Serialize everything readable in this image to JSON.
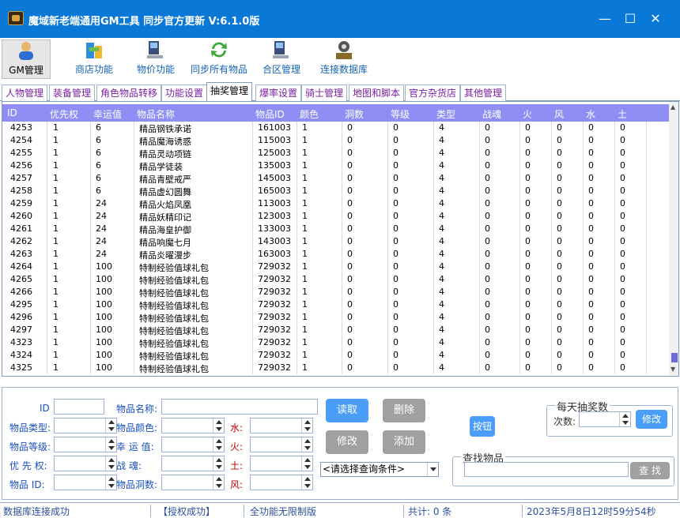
{
  "app": {
    "title": "魔域新老端通用GM工具 同步官方更新 V:6.1.0版"
  },
  "toolbar": {
    "items": [
      {
        "label": "GM管理",
        "icon": "user-icon"
      },
      {
        "label": "商店功能",
        "icon": "shop-icon"
      },
      {
        "label": "物价功能",
        "icon": "computer-icon"
      },
      {
        "label": "同步所有物品",
        "icon": "sync-icon"
      },
      {
        "label": "合区管理",
        "icon": "computer-icon"
      },
      {
        "label": "连接数据库",
        "icon": "database-gear-icon"
      }
    ]
  },
  "tabs": [
    "人物管理",
    "装备管理",
    "角色物品转移",
    "功能设置",
    "抽奖管理",
    "爆率设置",
    "骑士管理",
    "地图和脚本",
    "官方杂货店",
    "其他管理"
  ],
  "grid": {
    "columns": [
      "ID",
      "优先权",
      "幸运值",
      "物品名称",
      "物品ID",
      "颜色",
      "洞数",
      "等级",
      "类型",
      "战魂",
      "火",
      "风",
      "水",
      "土"
    ],
    "rows": [
      [
        "4253",
        "1",
        "6",
        "精品钢铁承诺",
        "161003",
        "1",
        "0",
        "0",
        "4",
        "0",
        "0",
        "0",
        "0",
        "0"
      ],
      [
        "4254",
        "1",
        "6",
        "精品魔海诱惑",
        "115003",
        "1",
        "0",
        "0",
        "4",
        "0",
        "0",
        "0",
        "0",
        "0"
      ],
      [
        "4255",
        "1",
        "6",
        "精品灵动项链",
        "125003",
        "1",
        "0",
        "0",
        "4",
        "0",
        "0",
        "0",
        "0",
        "0"
      ],
      [
        "4256",
        "1",
        "6",
        "精品学徒装",
        "135003",
        "1",
        "0",
        "0",
        "4",
        "0",
        "0",
        "0",
        "0",
        "0"
      ],
      [
        "4257",
        "1",
        "6",
        "精品青壁戒严",
        "145003",
        "1",
        "0",
        "0",
        "4",
        "0",
        "0",
        "0",
        "0",
        "0"
      ],
      [
        "4258",
        "1",
        "6",
        "精品虚幻圆舞",
        "165003",
        "1",
        "0",
        "0",
        "4",
        "0",
        "0",
        "0",
        "0",
        "0"
      ],
      [
        "4259",
        "1",
        "24",
        "精品火焰凤凰",
        "113003",
        "1",
        "0",
        "0",
        "4",
        "0",
        "0",
        "0",
        "0",
        "0"
      ],
      [
        "4260",
        "1",
        "24",
        "精品妖精印记",
        "123003",
        "1",
        "0",
        "0",
        "4",
        "0",
        "0",
        "0",
        "0",
        "0"
      ],
      [
        "4261",
        "1",
        "24",
        "精品海皇护御",
        "133003",
        "1",
        "0",
        "0",
        "4",
        "0",
        "0",
        "0",
        "0",
        "0"
      ],
      [
        "4262",
        "1",
        "24",
        "精品响魔七月",
        "143003",
        "1",
        "0",
        "0",
        "4",
        "0",
        "0",
        "0",
        "0",
        "0"
      ],
      [
        "4263",
        "1",
        "24",
        "精品炎曜漫步",
        "163003",
        "1",
        "0",
        "0",
        "4",
        "0",
        "0",
        "0",
        "0",
        "0"
      ],
      [
        "4264",
        "1",
        "100",
        "特制经验值球礼包",
        "729032",
        "1",
        "0",
        "0",
        "4",
        "0",
        "0",
        "0",
        "0",
        "0"
      ],
      [
        "4265",
        "1",
        "100",
        "特制经验值球礼包",
        "729032",
        "1",
        "0",
        "0",
        "4",
        "0",
        "0",
        "0",
        "0",
        "0"
      ],
      [
        "4266",
        "1",
        "100",
        "特制经验值球礼包",
        "729032",
        "1",
        "0",
        "0",
        "4",
        "0",
        "0",
        "0",
        "0",
        "0"
      ],
      [
        "4295",
        "1",
        "100",
        "特制经验值球礼包",
        "729032",
        "1",
        "0",
        "0",
        "4",
        "0",
        "0",
        "0",
        "0",
        "0"
      ],
      [
        "4296",
        "1",
        "100",
        "特制经验值球礼包",
        "729032",
        "1",
        "0",
        "0",
        "4",
        "0",
        "0",
        "0",
        "0",
        "0"
      ],
      [
        "4297",
        "1",
        "100",
        "特制经验值球礼包",
        "729032",
        "1",
        "0",
        "0",
        "4",
        "0",
        "0",
        "0",
        "0",
        "0"
      ],
      [
        "4323",
        "1",
        "100",
        "特制经验值球礼包",
        "729032",
        "1",
        "0",
        "0",
        "4",
        "0",
        "0",
        "0",
        "0",
        "0"
      ],
      [
        "4324",
        "1",
        "100",
        "特制经验值球礼包",
        "729032",
        "1",
        "0",
        "0",
        "4",
        "0",
        "0",
        "0",
        "0",
        "0"
      ],
      [
        "4325",
        "1",
        "100",
        "特制经验值球礼包",
        "729032",
        "1",
        "0",
        "0",
        "4",
        "0",
        "0",
        "0",
        "0",
        "0"
      ]
    ]
  },
  "form": {
    "id_label": "ID",
    "name_label": "物品名称:",
    "type_label": "物品类型:",
    "color_label": "物品颜色:",
    "level_label": "物品等级:",
    "luck_label": "幸 运 值:",
    "priority_label": "优 先 权:",
    "soul_label": "战    魂:",
    "itemid_label": "物品  ID:",
    "holes_label": "物品洞数:",
    "water_label": "水:",
    "fire_label": "火:",
    "earth_label": "土:",
    "wind_label": "风:",
    "read_btn": "读取",
    "delete_btn": "删除",
    "modify_btn": "修改",
    "add_btn": "添加",
    "query_placeholder": "<请选择查询条件>",
    "button_btn": "按钮",
    "daily_group": "每天抽奖数",
    "times_label": "次数:",
    "daily_modify_btn": "修改",
    "find_group": "查找物品",
    "find_btn": "查 找"
  },
  "status": {
    "db": "数据库连接成功",
    "auth": "【授权成功】",
    "version": "全功能无限制版",
    "count": "共计: 0 条",
    "datetime": "2023年5月8日12时59分54秒"
  },
  "colors": {
    "titlebar": "#0a78d7",
    "grid_header": "#8e8ef5",
    "tab_text": "#7a1fa2",
    "button_blue": "#4a9ef7",
    "button_gray": "#a0a0a0"
  }
}
